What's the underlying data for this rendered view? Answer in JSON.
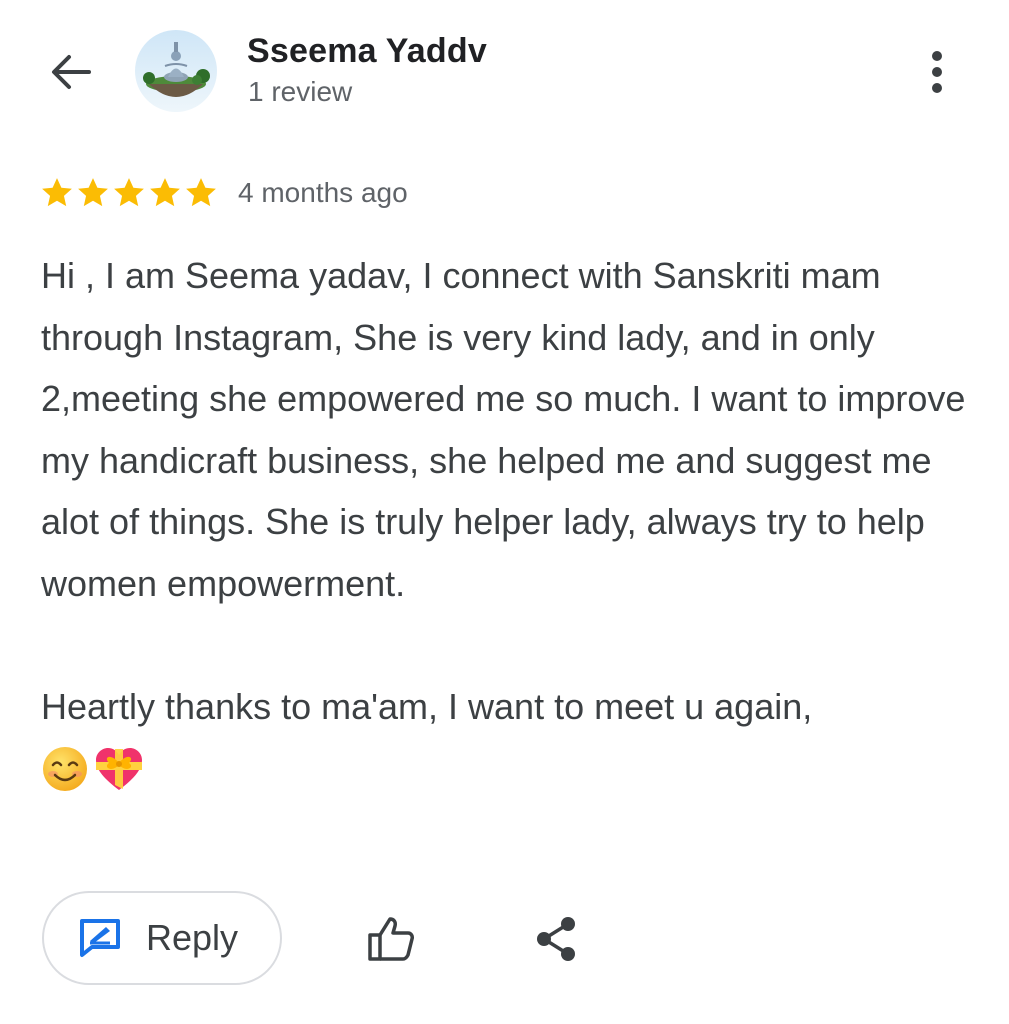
{
  "header": {
    "reviewer_name": "Sseema Yaddv",
    "review_count": "1 review"
  },
  "review": {
    "rating": 5,
    "max_rating": 5,
    "time_ago": "4 months ago",
    "paragraph_1": "Hi , I am Seema yadav, I connect with Sanskriti mam through Instagram, She is very kind lady, and in only 2,meeting she empowered me so much. I want to improve my handicraft business, she helped me and suggest me alot of things. She is truly helper lady, always try to help women empowerment.",
    "paragraph_2": "Heartly thanks to ma'am, I want to meet u again,",
    "emojis": [
      "smiling-face-emoji",
      "heart-with-ribbon-emoji"
    ]
  },
  "actions": {
    "reply_label": "Reply"
  },
  "colors": {
    "star": "#fbbc04",
    "reply_icon": "#1a73e8",
    "text": "#3c4043",
    "secondary_text": "#5f6368"
  }
}
